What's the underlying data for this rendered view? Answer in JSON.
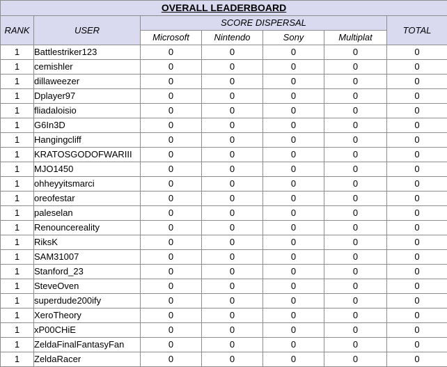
{
  "title": "OVERALL LEADERBOARD",
  "headers": {
    "rank": "RANK",
    "user": "USER",
    "score_dispersal": "SCORE DISPERSAL",
    "microsoft": "Microsoft",
    "nintendo": "Nintendo",
    "sony": "Sony",
    "multiplat": "Multiplat",
    "total": "TOTAL"
  },
  "rows": [
    {
      "rank": "1",
      "user": "Battlestriker123",
      "microsoft": "0",
      "nintendo": "0",
      "sony": "0",
      "multiplat": "0",
      "total": "0"
    },
    {
      "rank": "1",
      "user": "cemishler",
      "microsoft": "0",
      "nintendo": "0",
      "sony": "0",
      "multiplat": "0",
      "total": "0"
    },
    {
      "rank": "1",
      "user": "dillaweezer",
      "microsoft": "0",
      "nintendo": "0",
      "sony": "0",
      "multiplat": "0",
      "total": "0"
    },
    {
      "rank": "1",
      "user": "Dplayer97",
      "microsoft": "0",
      "nintendo": "0",
      "sony": "0",
      "multiplat": "0",
      "total": "0"
    },
    {
      "rank": "1",
      "user": "fliadaloisio",
      "microsoft": "0",
      "nintendo": "0",
      "sony": "0",
      "multiplat": "0",
      "total": "0"
    },
    {
      "rank": "1",
      "user": "G6In3D",
      "microsoft": "0",
      "nintendo": "0",
      "sony": "0",
      "multiplat": "0",
      "total": "0"
    },
    {
      "rank": "1",
      "user": "Hangingcliff",
      "microsoft": "0",
      "nintendo": "0",
      "sony": "0",
      "multiplat": "0",
      "total": "0"
    },
    {
      "rank": "1",
      "user": "KRATOSGODOFWARIII",
      "microsoft": "0",
      "nintendo": "0",
      "sony": "0",
      "multiplat": "0",
      "total": "0"
    },
    {
      "rank": "1",
      "user": "MJO1450",
      "microsoft": "0",
      "nintendo": "0",
      "sony": "0",
      "multiplat": "0",
      "total": "0"
    },
    {
      "rank": "1",
      "user": "ohheyyitsmarci",
      "microsoft": "0",
      "nintendo": "0",
      "sony": "0",
      "multiplat": "0",
      "total": "0"
    },
    {
      "rank": "1",
      "user": "oreofestar",
      "microsoft": "0",
      "nintendo": "0",
      "sony": "0",
      "multiplat": "0",
      "total": "0"
    },
    {
      "rank": "1",
      "user": "paleselan",
      "microsoft": "0",
      "nintendo": "0",
      "sony": "0",
      "multiplat": "0",
      "total": "0"
    },
    {
      "rank": "1",
      "user": "Renouncereality",
      "microsoft": "0",
      "nintendo": "0",
      "sony": "0",
      "multiplat": "0",
      "total": "0"
    },
    {
      "rank": "1",
      "user": "RiksK",
      "microsoft": "0",
      "nintendo": "0",
      "sony": "0",
      "multiplat": "0",
      "total": "0"
    },
    {
      "rank": "1",
      "user": "SAM31007",
      "microsoft": "0",
      "nintendo": "0",
      "sony": "0",
      "multiplat": "0",
      "total": "0"
    },
    {
      "rank": "1",
      "user": "Stanford_23",
      "microsoft": "0",
      "nintendo": "0",
      "sony": "0",
      "multiplat": "0",
      "total": "0"
    },
    {
      "rank": "1",
      "user": "SteveOven",
      "microsoft": "0",
      "nintendo": "0",
      "sony": "0",
      "multiplat": "0",
      "total": "0"
    },
    {
      "rank": "1",
      "user": "superdude200ify",
      "microsoft": "0",
      "nintendo": "0",
      "sony": "0",
      "multiplat": "0",
      "total": "0"
    },
    {
      "rank": "1",
      "user": "XeroTheory",
      "microsoft": "0",
      "nintendo": "0",
      "sony": "0",
      "multiplat": "0",
      "total": "0"
    },
    {
      "rank": "1",
      "user": "xP00CHiE",
      "microsoft": "0",
      "nintendo": "0",
      "sony": "0",
      "multiplat": "0",
      "total": "0"
    },
    {
      "rank": "1",
      "user": "ZeldaFinalFantasyFan",
      "microsoft": "0",
      "nintendo": "0",
      "sony": "0",
      "multiplat": "0",
      "total": "0"
    },
    {
      "rank": "1",
      "user": "ZeldaRacer",
      "microsoft": "0",
      "nintendo": "0",
      "sony": "0",
      "multiplat": "0",
      "total": "0"
    }
  ]
}
